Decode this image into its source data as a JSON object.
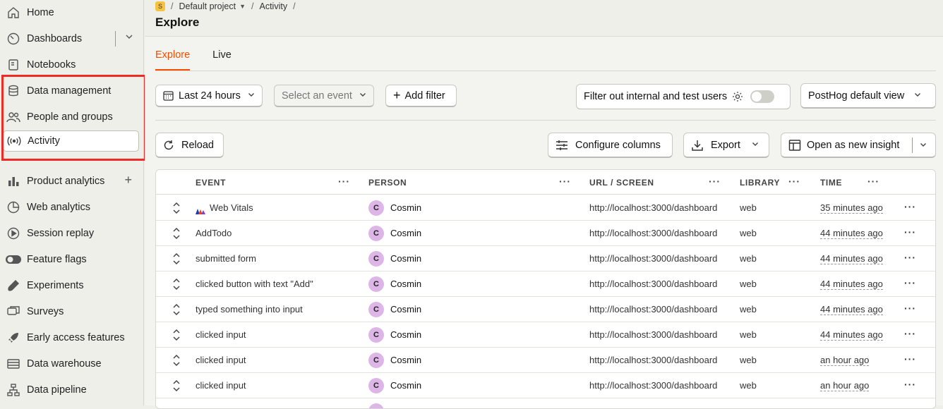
{
  "sidebar": {
    "items": [
      {
        "label": "Home",
        "icon": "home-icon"
      },
      {
        "label": "Dashboards",
        "icon": "dashboard-icon"
      },
      {
        "label": "Notebooks",
        "icon": "notebook-icon"
      },
      {
        "label": "Data management",
        "icon": "database-icon"
      },
      {
        "label": "People and groups",
        "icon": "people-icon"
      },
      {
        "label": "Activity",
        "icon": "broadcast-icon"
      },
      {
        "label": "Product analytics",
        "icon": "bar-chart-icon"
      },
      {
        "label": "Web analytics",
        "icon": "pie-chart-icon"
      },
      {
        "label": "Session replay",
        "icon": "replay-icon"
      },
      {
        "label": "Feature flags",
        "icon": "toggle-icon"
      },
      {
        "label": "Experiments",
        "icon": "flask-icon"
      },
      {
        "label": "Surveys",
        "icon": "chat-icon"
      },
      {
        "label": "Early access features",
        "icon": "rocket-icon"
      },
      {
        "label": "Data warehouse",
        "icon": "warehouse-icon"
      },
      {
        "label": "Data pipeline",
        "icon": "pipeline-icon"
      }
    ]
  },
  "breadcrumb": {
    "project_badge": "S",
    "project": "Default project",
    "section": "Activity"
  },
  "page_title": "Explore",
  "tabs": [
    {
      "label": "Explore",
      "active": true
    },
    {
      "label": "Live",
      "active": false
    }
  ],
  "filters": {
    "date_range": "Last 24 hours",
    "event_placeholder": "Select an event",
    "add_filter": "Add filter",
    "internal_filter": "Filter out internal and test users",
    "view": "PostHog default view"
  },
  "actions": {
    "reload": "Reload",
    "configure_columns": "Configure columns",
    "export": "Export",
    "open_insight": "Open as new insight"
  },
  "table": {
    "columns": [
      "EVENT",
      "PERSON",
      "URL / SCREEN",
      "LIBRARY",
      "TIME"
    ],
    "rows": [
      {
        "event": "Web Vitals",
        "person_initial": "C",
        "person": "Cosmin",
        "url": "http://localhost:3000/dashboard",
        "library": "web",
        "time": "35 minutes ago"
      },
      {
        "event": "AddTodo",
        "person_initial": "C",
        "person": "Cosmin",
        "url": "http://localhost:3000/dashboard",
        "library": "web",
        "time": "44 minutes ago"
      },
      {
        "event": "submitted form",
        "person_initial": "C",
        "person": "Cosmin",
        "url": "http://localhost:3000/dashboard",
        "library": "web",
        "time": "44 minutes ago"
      },
      {
        "event": "clicked button with text \"Add\"",
        "person_initial": "C",
        "person": "Cosmin",
        "url": "http://localhost:3000/dashboard",
        "library": "web",
        "time": "44 minutes ago"
      },
      {
        "event": "typed something into input",
        "person_initial": "C",
        "person": "Cosmin",
        "url": "http://localhost:3000/dashboard",
        "library": "web",
        "time": "44 minutes ago"
      },
      {
        "event": "clicked input",
        "person_initial": "C",
        "person": "Cosmin",
        "url": "http://localhost:3000/dashboard",
        "library": "web",
        "time": "44 minutes ago"
      },
      {
        "event": "clicked input",
        "person_initial": "C",
        "person": "Cosmin",
        "url": "http://localhost:3000/dashboard",
        "library": "web",
        "time": "an hour ago"
      },
      {
        "event": "clicked input",
        "person_initial": "C",
        "person": "Cosmin",
        "url": "http://localhost:3000/dashboard",
        "library": "web",
        "time": "an hour ago"
      }
    ]
  },
  "colors": {
    "accent": "#f54e00",
    "highlight_box": "#ee2b24",
    "avatar_bg": "#ddb5e6"
  }
}
